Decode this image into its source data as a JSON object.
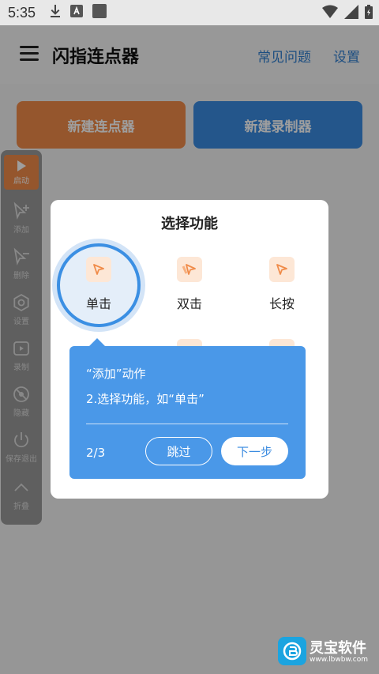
{
  "status": {
    "time": "5:35"
  },
  "app": {
    "title": "闪指连点器",
    "faq": "常见问题",
    "settings": "设置"
  },
  "actions": {
    "new_clicker": "新建连点器",
    "new_recorder": "新建录制器"
  },
  "floatbar": {
    "items": [
      "启动",
      "添加",
      "删除",
      "设置",
      "录制",
      "隐藏",
      "保存退出",
      "折叠"
    ]
  },
  "dialog": {
    "title": "选择功能",
    "functions": [
      "单击",
      "双击",
      "长按"
    ]
  },
  "tip": {
    "line1": "“添加”动作",
    "line2": "2.选择功能，如“单击”",
    "step": "2/3",
    "skip": "跳过",
    "next": "下一步"
  },
  "watermark": {
    "name": "灵宝软件",
    "url": "www.lbwbw.com"
  },
  "colors": {
    "accent_blue": "#3b8fe3",
    "accent_orange": "#f08c4a"
  }
}
